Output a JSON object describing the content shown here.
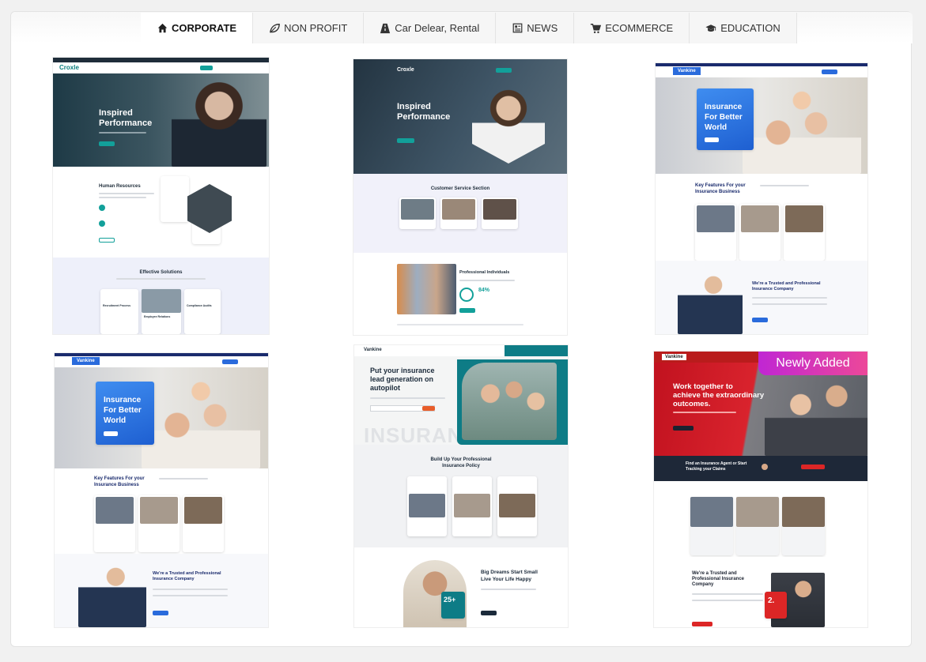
{
  "tabs": [
    {
      "label": "CORPORATE",
      "icon": "home-icon",
      "active": true
    },
    {
      "label": "NON PROFIT",
      "icon": "leaf-icon",
      "active": false
    },
    {
      "label": "Car Delear, Rental",
      "icon": "road-icon",
      "active": false
    },
    {
      "label": "NEWS",
      "icon": "newspaper-icon",
      "active": false
    },
    {
      "label": "ECOMMERCE",
      "icon": "cart-icon",
      "active": false
    },
    {
      "label": "EDUCATION",
      "icon": "graduation-cap-icon",
      "active": false
    }
  ],
  "thumbs": {
    "t1": {
      "logo": "Croxle",
      "hero_title_1": "Inspired",
      "hero_title_2": "Performance",
      "section1": "Human Resources",
      "section2": "Effective Solutions",
      "card1": "Recruitment Process",
      "card2": "Employee Relations",
      "card3": "Compliance Audits"
    },
    "t2": {
      "logo": "Croxle",
      "hero_title_1": "Inspired",
      "hero_title_2": "Performance",
      "section1": "Customer Service Section",
      "section2": "Professional Individuals",
      "stat": "84%"
    },
    "t3": {
      "logo": "Vankine",
      "hero_title_1": "Insurance",
      "hero_title_2": "For Better",
      "hero_title_3": "World",
      "section1_1": "Key Features For your",
      "section1_2": "Insurance Business",
      "section2_1": "We're a Trusted and Professional",
      "section2_2": "Insurance Company"
    },
    "t4": {
      "logo": "Vankine",
      "hero_title_1": "Insurance",
      "hero_title_2": "For Better",
      "hero_title_3": "World",
      "section1_1": "Key Features For your",
      "section1_2": "Insurance Business",
      "section2_1": "We're a Trusted and Professional",
      "section2_2": "Insurance Company"
    },
    "t5": {
      "logo": "Vankine",
      "hero_title_1": "Put your insurance",
      "hero_title_2": "lead generation on",
      "hero_title_3": "autopilot",
      "watermark": "INSURANCE",
      "section1_1": "Build Up Your Professional",
      "section1_2": "Insurance Policy",
      "section2_1": "Big Dreams Start Small",
      "section2_2": "Live Your Life Happy",
      "stat": "25+"
    },
    "t6": {
      "logo": "Vankine",
      "badge": "Newly Added",
      "hero_title_1": "Work together to",
      "hero_title_2": "achieve the extraordinary",
      "hero_title_3": "outcomes.",
      "band_1": "Find an Insurance Agent or Start",
      "band_2": "Tracking your Claims",
      "section2_1": "We're a Trusted and",
      "section2_2": "Professional Insurance",
      "section2_3": "Company",
      "stat": "2."
    }
  }
}
